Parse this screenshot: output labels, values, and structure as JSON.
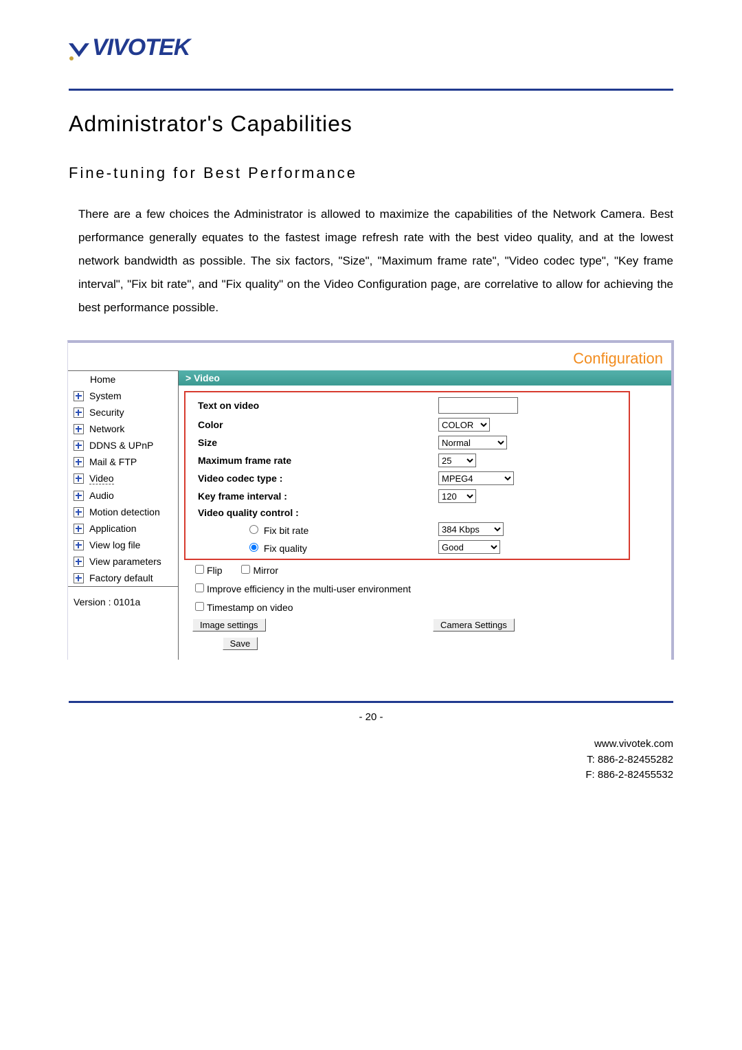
{
  "brand": "VIVOTEK",
  "h1": "Administrator's Capabilities",
  "h2": "Fine-tuning for Best Performance",
  "para": "There are a few choices the Administrator is allowed to maximize the capabilities of the Network Camera. Best performance generally equates to the fastest image refresh rate with the best video quality, and at the lowest network bandwidth as possible. The six factors, \"Size\", \"Maximum frame rate\", \"Video codec type\", \"Key frame interval\", \"Fix bit rate\", and \"Fix quality\" on the Video Configuration page, are correlative to allow for achieving the best performance possible.",
  "config": {
    "title": "Configuration",
    "section": "> Video",
    "sidebar": {
      "home": "Home",
      "items": [
        "System",
        "Security",
        "Network",
        "DDNS & UPnP",
        "Mail & FTP",
        "Video",
        "Audio",
        "Motion detection",
        "Application",
        "View log file",
        "View parameters",
        "Factory default"
      ],
      "active_index": 5,
      "version": "Version : 0101a"
    },
    "form": {
      "text_on_video_label": "Text on video",
      "text_on_video_value": "",
      "color_label": "Color",
      "color_value": "COLOR",
      "size_label": "Size",
      "size_value": "Normal",
      "max_fr_label": "Maximum frame rate",
      "max_fr_value": "25",
      "codec_label": "Video codec type :",
      "codec_value": "MPEG4",
      "kfi_label": "Key frame interval :",
      "kfi_value": "120",
      "vqc_label": "Video quality control :",
      "bitrate_label": "Fix bit rate",
      "bitrate_value": "384 Kbps",
      "quality_label": "Fix quality",
      "quality_value": "Good",
      "flip": "Flip",
      "mirror": "Mirror",
      "improve": "Improve efficiency in the multi-user environment",
      "timestamp": "Timestamp on video",
      "image_settings": "Image settings",
      "camera_settings": "Camera Settings",
      "save": "Save"
    }
  },
  "page_num": "- 20 -",
  "footer": {
    "url": "www.vivotek.com",
    "tel": "T: 886-2-82455282",
    "fax": "F: 886-2-82455532"
  }
}
